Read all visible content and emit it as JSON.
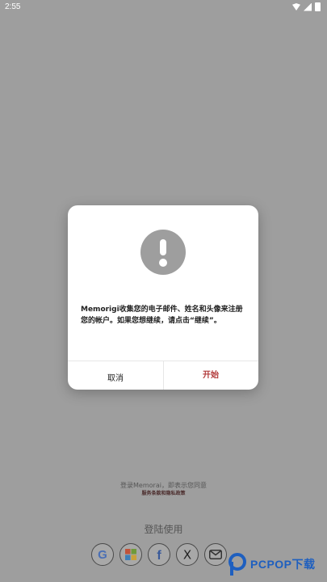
{
  "status_bar": {
    "time": "2:55",
    "icons": [
      "wifi-icon",
      "signal-icon",
      "battery-icon"
    ]
  },
  "bottom": {
    "terms_line1": "登录Memorai，即表示您同意",
    "terms_line2": "服务条款和隐私政策",
    "login_heading": "登陆使用",
    "social_buttons": [
      {
        "name": "google-icon",
        "label": "G"
      },
      {
        "name": "microsoft-icon"
      },
      {
        "name": "facebook-icon",
        "label": "f"
      },
      {
        "name": "x-icon",
        "label": "X"
      },
      {
        "name": "email-icon"
      }
    ]
  },
  "watermark": {
    "text": "PCPOP下载"
  },
  "dialog": {
    "icon": "alert-icon",
    "message": "Memorigi收集您的电子邮件、姓名和头像来注册您的帐户。如果您想继续，请点击“继续”。",
    "cancel_label": "取消",
    "start_label": "开始"
  },
  "colors": {
    "overlay": "#9e9e9e",
    "accent": "#b23a3a",
    "watermark": "#1e5fbf"
  }
}
